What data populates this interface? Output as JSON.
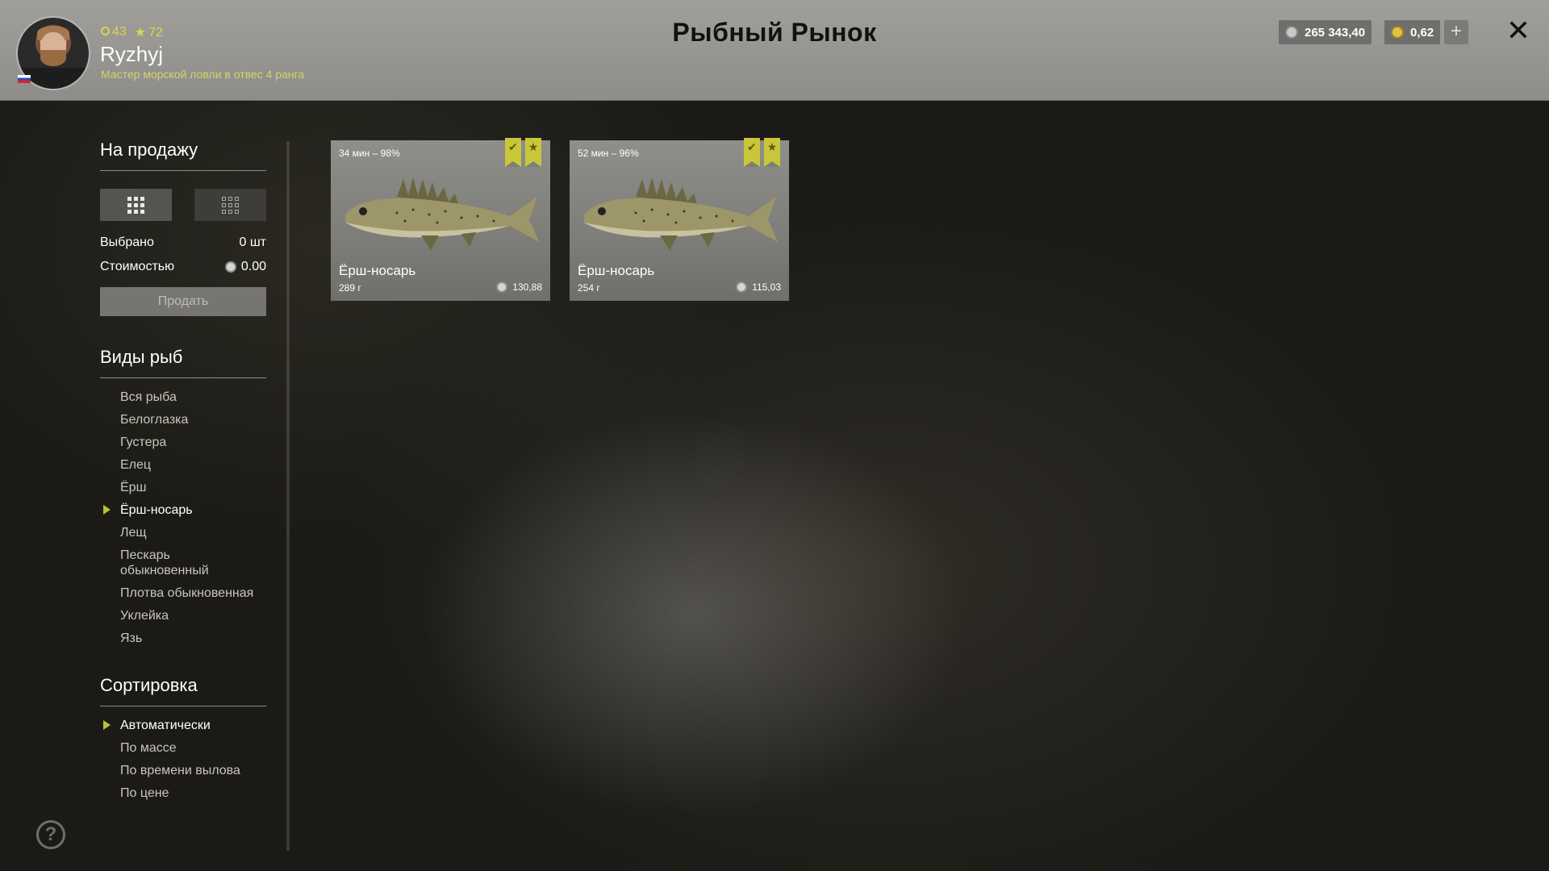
{
  "header": {
    "level": "43",
    "stars": "72",
    "username": "Ryzhyj",
    "rank": "Мастер морской ловли в отвес 4 ранга",
    "title": "Рыбный Рынок",
    "silver": "265 343,40",
    "gold": "0,62",
    "plus": "+",
    "close": "✕"
  },
  "sale": {
    "title": "На продажу",
    "selected_label": "Выбрано",
    "selected_value": "0 шт",
    "cost_label": "Стоимостью",
    "cost_value": "0.00",
    "sell_button": "Продать"
  },
  "species": {
    "title": "Виды рыб",
    "items": [
      "Вся рыба",
      "Белоглазка",
      "Густера",
      "Елец",
      "Ёрш",
      "Ёрш-носарь",
      "Лещ",
      "Пескарь обыкновенный",
      "Плотва обыкновенная",
      "Уклейка",
      "Язь"
    ],
    "active_index": 5
  },
  "sort": {
    "title": "Сортировка",
    "items": [
      "Автоматически",
      "По массе",
      "По времени вылова",
      "По цене"
    ],
    "active_index": 0
  },
  "cards": [
    {
      "time": "34 мин – 98%",
      "name": "Ёрш-носарь",
      "weight": "289 г",
      "price": "130,88"
    },
    {
      "time": "52 мин – 96%",
      "name": "Ёрш-носарь",
      "weight": "254 г",
      "price": "115,03"
    }
  ],
  "help": "?",
  "colors": {
    "accent": "#b9c234",
    "badge": "#c9c63a",
    "header_bg": "#9a9995"
  }
}
